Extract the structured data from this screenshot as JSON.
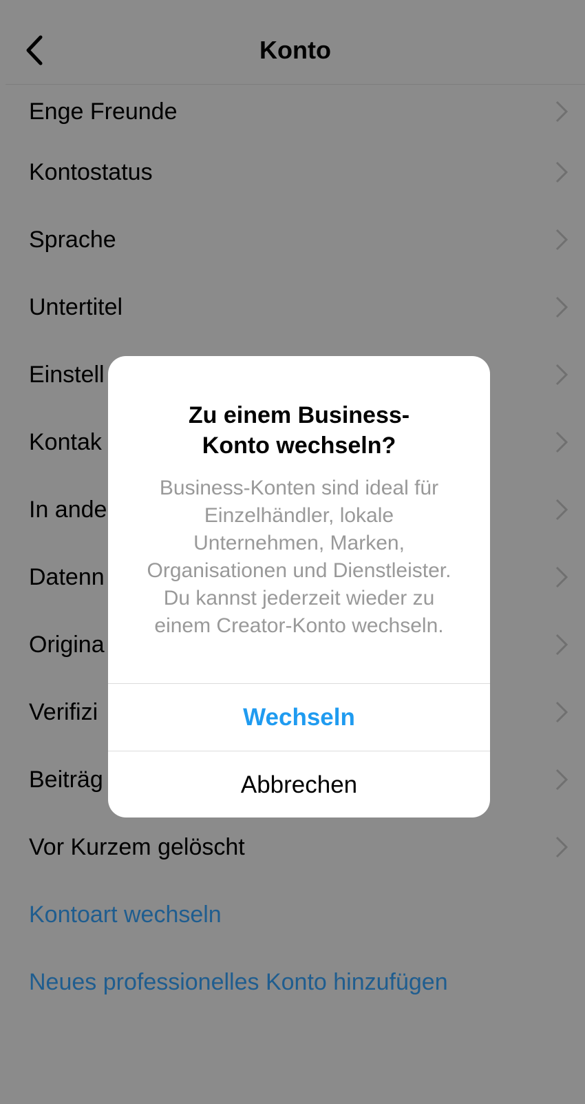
{
  "header": {
    "title": "Konto",
    "back_icon": "chevron-left-icon"
  },
  "list": {
    "items": [
      {
        "label": "Enge Freunde"
      },
      {
        "label": "Kontostatus"
      },
      {
        "label": "Sprache"
      },
      {
        "label": "Untertitel"
      },
      {
        "label": "Einstell"
      },
      {
        "label": "Kontak"
      },
      {
        "label": "In ande"
      },
      {
        "label": "Datenn"
      },
      {
        "label": "Origina"
      },
      {
        "label": "Verifizi"
      },
      {
        "label": "Beiträg"
      },
      {
        "label": "Vor Kurzem gelöscht"
      }
    ],
    "links": [
      {
        "label": "Kontoart wechseln"
      },
      {
        "label": "Neues professionelles Konto hinzufügen"
      }
    ],
    "link_color": "#1f5d8f"
  },
  "dialog": {
    "title_line1": "Zu einem Business-",
    "title_line2": "Konto wechseln?",
    "message_lines": [
      "Business-Konten sind ideal für",
      "Einzelhändler, lokale",
      "Unternehmen, Marken,",
      "Organisationen und Dienstleister.",
      "Du kannst jederzeit wieder zu",
      "einem Creator-Konto wechseln."
    ],
    "confirm_label": "Wechseln",
    "cancel_label": "Abbrechen",
    "confirm_color": "#1f9bf0"
  },
  "colors": {
    "overlay_background": "#8b8b8b",
    "dialog_background": "#ffffff"
  }
}
